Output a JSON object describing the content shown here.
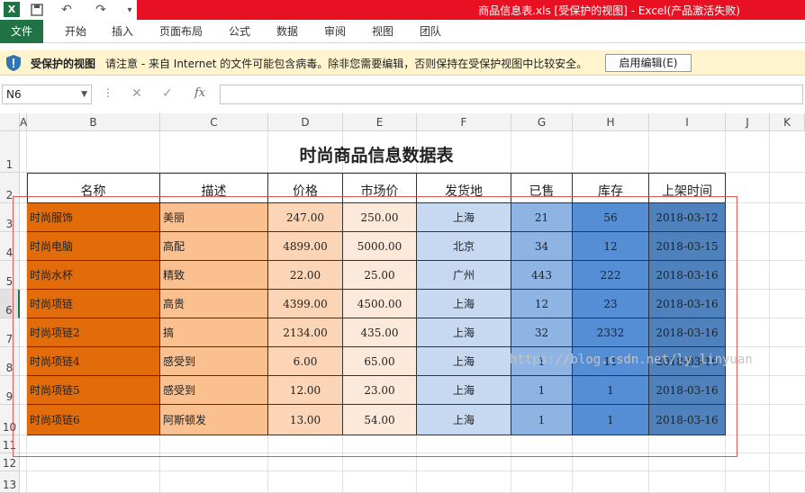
{
  "window": {
    "title": "商品信息表.xls  [受保护的视图]  -  Excel(产品激活失败)",
    "app_icon": "X"
  },
  "ribbon": {
    "tabs": [
      "文件",
      "开始",
      "插入",
      "页面布局",
      "公式",
      "数据",
      "审阅",
      "视图",
      "团队"
    ]
  },
  "protected_view": {
    "title": "受保护的视图",
    "message": "请注意 - 来自 Internet 的文件可能包含病毒。除非您需要编辑，否则保持在受保护视图中比较安全。",
    "button": "启用编辑(E)"
  },
  "formula_bar": {
    "name_box": "N6",
    "fx": "fx",
    "value": ""
  },
  "columns": [
    "A",
    "B",
    "C",
    "D",
    "E",
    "F",
    "G",
    "H",
    "I",
    "J",
    "K"
  ],
  "rows": [
    "1",
    "2",
    "3",
    "4",
    "5",
    "6",
    "7",
    "8",
    "9",
    "10",
    "11",
    "12",
    "13"
  ],
  "sheet": {
    "title": "时尚商品信息数据表",
    "headers": [
      "名称",
      "描述",
      "价格",
      "市场价",
      "发货地",
      "已售",
      "库存",
      "上架时间"
    ],
    "data": [
      [
        "时尚服饰",
        "美丽",
        "247.00",
        "250.00",
        "上海",
        "21",
        "56",
        "2018-03-12"
      ],
      [
        "时尚电脑",
        "高配",
        "4899.00",
        "5000.00",
        "北京",
        "34",
        "12",
        "2018-03-15"
      ],
      [
        "时尚水杯",
        "精致",
        "22.00",
        "25.00",
        "广州",
        "443",
        "222",
        "2018-03-16"
      ],
      [
        "时尚项链",
        "高贵",
        "4399.00",
        "4500.00",
        "上海",
        "12",
        "23",
        "2018-03-16"
      ],
      [
        "时尚项链2",
        "搞",
        "2134.00",
        "435.00",
        "上海",
        "32",
        "2332",
        "2018-03-16"
      ],
      [
        "时尚项链4",
        "感受到",
        "6.00",
        "65.00",
        "上海",
        "1",
        "11",
        "2018-03-16"
      ],
      [
        "时尚项链5",
        "感受到",
        "12.00",
        "23.00",
        "上海",
        "1",
        "1",
        "2018-03-16"
      ],
      [
        "时尚项链6",
        "阿斯顿发",
        "13.00",
        "54.00",
        "上海",
        "1",
        "1",
        "2018-03-16"
      ]
    ],
    "column_colors": [
      "#e36c0a",
      "#fac08f",
      "#fbd5b5",
      "#fde9d9",
      "#c6d9f1",
      "#8eb4e3",
      "#558ed5",
      "#4f81bd"
    ]
  },
  "watermark": "https://blog.csdn.net/ly_linyuan"
}
